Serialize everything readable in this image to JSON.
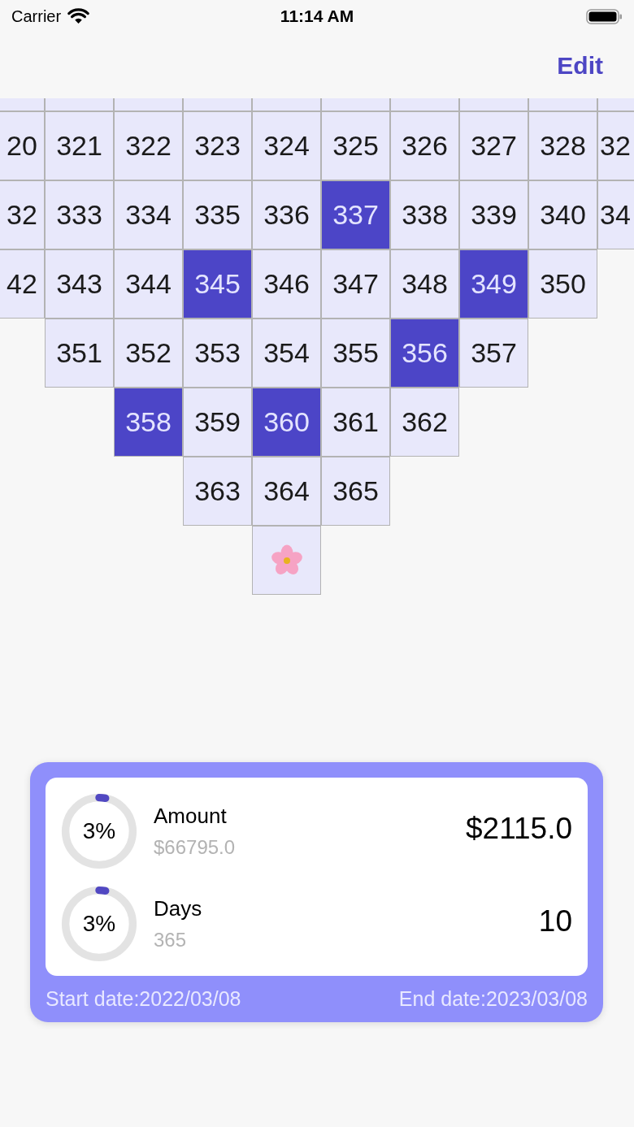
{
  "status_bar": {
    "carrier": "Carrier",
    "time": "11:14 AM"
  },
  "nav_bar": {
    "edit_button": "Edit"
  },
  "calendar_grid": {
    "partial_row": [
      {
        "selected": false
      },
      {
        "selected": false
      },
      {
        "selected": false
      },
      {
        "selected": false
      },
      {
        "selected": false
      },
      {
        "selected": false
      },
      {
        "selected": false
      },
      {
        "selected": false
      },
      {
        "selected": false
      },
      {
        "selected": false
      }
    ],
    "rows": [
      {
        "cells": [
          {
            "kind": "day",
            "label": "20",
            "selected": false
          },
          {
            "kind": "day",
            "label": "321",
            "selected": false
          },
          {
            "kind": "day",
            "label": "322",
            "selected": false
          },
          {
            "kind": "day",
            "label": "323",
            "selected": false
          },
          {
            "kind": "day",
            "label": "324",
            "selected": false
          },
          {
            "kind": "day",
            "label": "325",
            "selected": false
          },
          {
            "kind": "day",
            "label": "326",
            "selected": false
          },
          {
            "kind": "day",
            "label": "327",
            "selected": false
          },
          {
            "kind": "day",
            "label": "328",
            "selected": false
          },
          {
            "kind": "day",
            "label": "32",
            "selected": false
          }
        ]
      },
      {
        "cells": [
          {
            "kind": "day",
            "label": "32",
            "selected": false
          },
          {
            "kind": "day",
            "label": "333",
            "selected": false
          },
          {
            "kind": "day",
            "label": "334",
            "selected": false
          },
          {
            "kind": "day",
            "label": "335",
            "selected": false
          },
          {
            "kind": "day",
            "label": "336",
            "selected": false
          },
          {
            "kind": "day",
            "label": "337",
            "selected": true
          },
          {
            "kind": "day",
            "label": "338",
            "selected": false
          },
          {
            "kind": "day",
            "label": "339",
            "selected": false
          },
          {
            "kind": "day",
            "label": "340",
            "selected": false
          },
          {
            "kind": "day",
            "label": "34",
            "selected": false
          }
        ]
      },
      {
        "cells": [
          {
            "kind": "day",
            "label": "42",
            "selected": false
          },
          {
            "kind": "day",
            "label": "343",
            "selected": false
          },
          {
            "kind": "day",
            "label": "344",
            "selected": false
          },
          {
            "kind": "day",
            "label": "345",
            "selected": true
          },
          {
            "kind": "day",
            "label": "346",
            "selected": false
          },
          {
            "kind": "day",
            "label": "347",
            "selected": false
          },
          {
            "kind": "day",
            "label": "348",
            "selected": false
          },
          {
            "kind": "day",
            "label": "349",
            "selected": true
          },
          {
            "kind": "day",
            "label": "350",
            "selected": false
          }
        ]
      },
      {
        "cells": [
          {
            "kind": "blank"
          },
          {
            "kind": "day",
            "label": "351",
            "selected": false
          },
          {
            "kind": "day",
            "label": "352",
            "selected": false
          },
          {
            "kind": "day",
            "label": "353",
            "selected": false
          },
          {
            "kind": "day",
            "label": "354",
            "selected": false
          },
          {
            "kind": "day",
            "label": "355",
            "selected": false
          },
          {
            "kind": "day",
            "label": "356",
            "selected": true
          },
          {
            "kind": "day",
            "label": "357",
            "selected": false
          }
        ]
      },
      {
        "cells": [
          {
            "kind": "blank"
          },
          {
            "kind": "blank"
          },
          {
            "kind": "day",
            "label": "358",
            "selected": true
          },
          {
            "kind": "day",
            "label": "359",
            "selected": false
          },
          {
            "kind": "day",
            "label": "360",
            "selected": true
          },
          {
            "kind": "day",
            "label": "361",
            "selected": false
          },
          {
            "kind": "day",
            "label": "362",
            "selected": false
          }
        ]
      },
      {
        "cells": [
          {
            "kind": "blank"
          },
          {
            "kind": "blank"
          },
          {
            "kind": "blank"
          },
          {
            "kind": "day",
            "label": "363",
            "selected": false
          },
          {
            "kind": "day",
            "label": "364",
            "selected": false
          },
          {
            "kind": "day",
            "label": "365",
            "selected": false
          }
        ]
      },
      {
        "cells": [
          {
            "kind": "blank"
          },
          {
            "kind": "blank"
          },
          {
            "kind": "blank"
          },
          {
            "kind": "blank"
          },
          {
            "kind": "flower",
            "selected": false
          }
        ]
      }
    ]
  },
  "summary_card": {
    "stats": [
      {
        "percent": "3%",
        "level": 0.03,
        "title": "Amount",
        "subtitle": "$66795.0",
        "value": "$2115.0"
      },
      {
        "percent": "3%",
        "level": 0.03,
        "title": "Days",
        "subtitle": "365",
        "value": "10"
      }
    ],
    "start_date": "Start date:2022/03/08",
    "end_date": "End date:2023/03/08"
  }
}
